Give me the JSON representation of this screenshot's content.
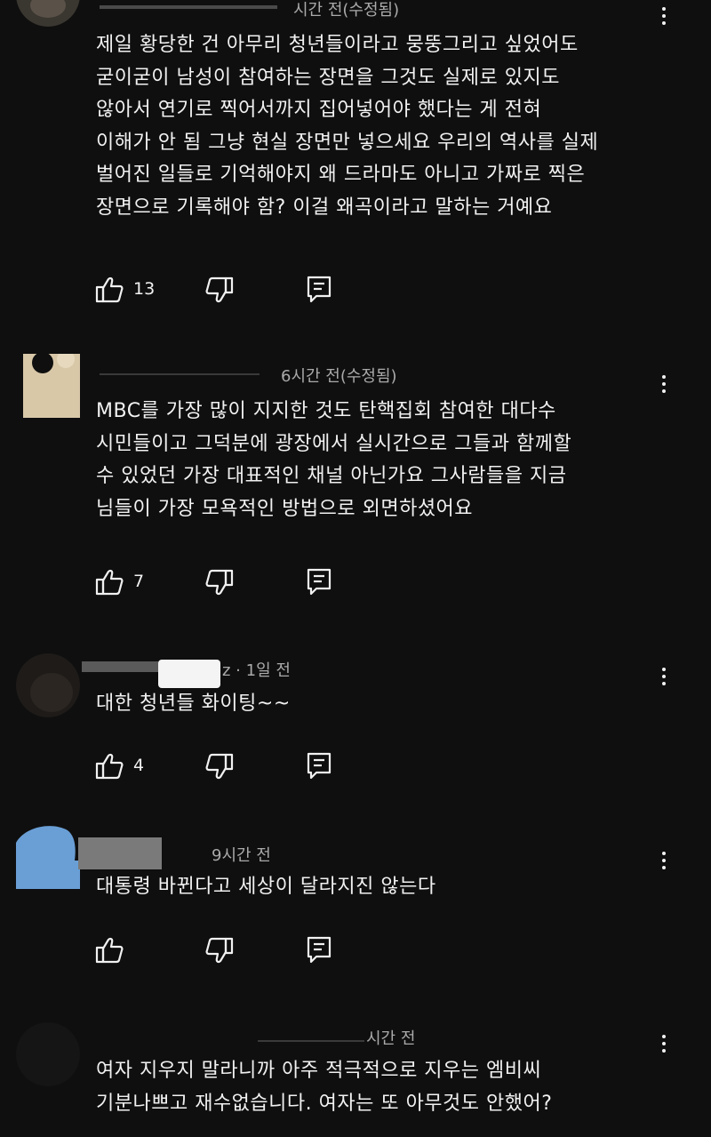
{
  "comments": [
    {
      "meta": "시간 전(수정됨)",
      "lines": [
        "제일 황당한 건 아무리 청년들이라고 뭉뚱그리고 싶었어도",
        "굳이굳이 남성이 참여하는 장면을 그것도 실제로 있지도",
        "않아서 연기로 찍어서까지 집어넣어야 했다는 게 전혀",
        "이해가 안 됨 그냥 현실 장면만 넣으세요 우리의 역사를 실제",
        "벌어진 일들로 기억해야지 왜 드라마도 아니고 가짜로 찍은",
        "장면으로 기록해야 함? 이걸 왜곡이라고 말하는 거예요"
      ],
      "likes": "13"
    },
    {
      "meta": "6시간 전(수정됨)",
      "lines": [
        "MBC를 가장 많이 지지한 것도 탄핵집회 참여한 대다수",
        "시민들이고 그덕분에 광장에서 실시간으로 그들과 함께할",
        "수 있었던 가장 대표적인 채널 아닌가요 그사람들을 지금",
        "님들이 가장 모욕적인 방법으로 외면하셨어요"
      ],
      "likes": "7"
    },
    {
      "meta": "z · 1일 전",
      "lines": [
        "대한 청년들 화이팅~~"
      ],
      "likes": "4"
    },
    {
      "meta": "9시간 전",
      "lines": [
        "대통령 바뀐다고 세상이 달라지진 않는다"
      ],
      "likes": ""
    },
    {
      "meta": "시간 전",
      "lines": [
        "여자 지우지 말라니까 아주 적극적으로 지우는 엠비씨",
        "기분나쁘고 재수없습니다.  여자는 또 아무것도 안했어?"
      ],
      "likes": ""
    }
  ],
  "colors": {
    "background": "#0f0f0f",
    "text": "#f1f1f1",
    "meta": "#aaaaaa"
  },
  "icons": {
    "like": "thumbs-up-icon",
    "dislike": "thumbs-down-icon",
    "reply": "reply-icon",
    "more": "more-vert-icon"
  }
}
